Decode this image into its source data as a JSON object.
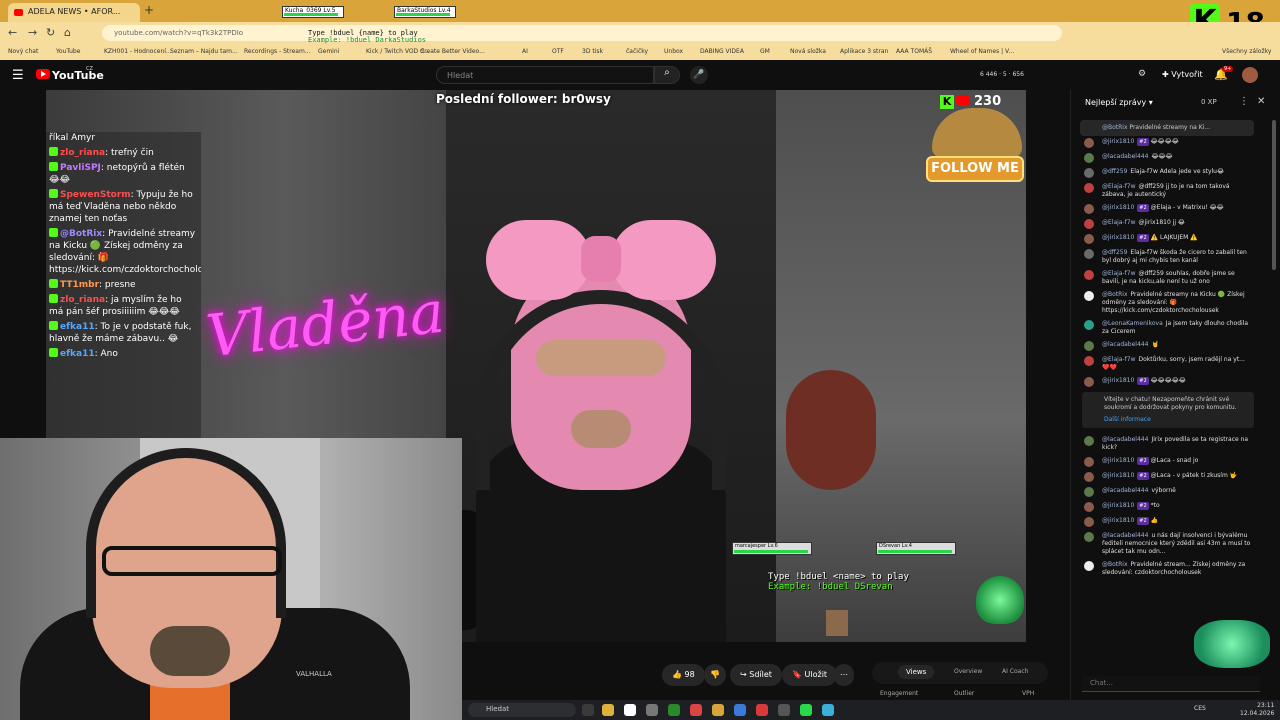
{
  "browser": {
    "tab_title": "ADELA NEWS • AFOR...",
    "url": "youtube.com/watch?v=qTk3k2TPDIo",
    "bookmarks": [
      "Nový chat",
      "YouTube",
      "KZH001 - Hodnocení...",
      "Seznam – Najdu tam...",
      "Recordings - Stream...",
      "Gemini",
      "Kick / Twitch VOD d...",
      "Create Better Video...",
      "AI",
      "OTF",
      "3D tisk",
      "čačičky",
      "Unbox",
      "DABING VIDEA",
      "GM",
      "Nová složka",
      "Aplikace 3 stran",
      "AAA TOMÁŠ",
      "Wheel of Names | V...",
      "Všechny záložky"
    ],
    "hp_bars": [
      "Kucha_0369  Lv.5",
      "BarkaStudios  Lv.4"
    ],
    "kick_badge": {
      "letter": "K",
      "number": "18"
    }
  },
  "cheer_text": {
    "line1": "Type !bduel {name} to play",
    "line2": "Example: !bduel DarkaStudios"
  },
  "youtube": {
    "brand": "YouTube",
    "brand_suffix": "CZ",
    "search_placeholder": "Hledat",
    "stats": "6 446  ·  5  ·  656",
    "create_label": "Vytvořit",
    "notif_count": "9+"
  },
  "stream": {
    "last_follower": "Poslední follower: br0wsy",
    "viewers": "230",
    "follow_me": "FOLLOW ME",
    "neon_sign": "Vladěna",
    "duel_line1": "Type !bduel <name> to play",
    "duel_line2": "Example: !bduel DSrevan",
    "minibars": [
      "marcajesper Lv.6",
      "DSrevan Lv.4"
    ],
    "webcam_brand": "VALHALLA"
  },
  "overlay_chat": [
    {
      "user": "",
      "text": "říkal Amyr",
      "color": "#ffffff"
    },
    {
      "user": "zlo_riana",
      "text": ": trefný čin",
      "color": "#ff4d4d"
    },
    {
      "user": "PavliSPJ",
      "text": ": netopýrů a flétén 😂😂",
      "color": "#c27bff"
    },
    {
      "user": "SpewenStorm",
      "text": ": Typuju že ho má teď Vladěna nebo někdo znamej ten noťas",
      "color": "#ff4d4d"
    },
    {
      "user": "@BotRix",
      "text": ": Pravidelné streamy na Kicku 🟢 Získej odměny za sledování: 🎁 https://kick.com/czdoktorchocholousek",
      "color": "#9b8cff"
    },
    {
      "user": "TT1mbr",
      "text": ": presne",
      "color": "#ff9b4d"
    },
    {
      "user": "zlo_riana",
      "text": ": ja myslím že ho má pán šéf prosiiiiiim 😂😂😂",
      "color": "#ff4d4d"
    },
    {
      "user": "efka11",
      "text": ": To je v podstatě fuk, hlavně že máme zábavu.. 😂",
      "color": "#53a8ff"
    },
    {
      "user": "efka11",
      "text": ": Ano",
      "color": "#53a8ff"
    }
  ],
  "below_video": {
    "likes": "98",
    "share_label": "Sdílet",
    "save_label": "Uložit",
    "tabs": [
      "Views",
      "Overview",
      "AI Coach"
    ],
    "sub_labels": [
      "Engagement",
      "Outlier",
      "VPH"
    ]
  },
  "live_chat": {
    "header": "Nejlepší zprávy",
    "xp": "0 XP",
    "pinned_user": "@BotRix",
    "pinned_text": "Pravidelné streamy na Ki...",
    "input_placeholder": "Chat...",
    "notice": {
      "text": "Vítejte v chatu! Nezapomeňte chránit své soukromí a dodržovat pokyny pro komunitu.",
      "link": "Další informace"
    },
    "messages": [
      {
        "user": "@jirix1810",
        "member": "#2",
        "text": "😂😂😂😂",
        "avatar": "#8a5a4a"
      },
      {
        "user": "@lacadabel444",
        "member": "",
        "text": "😂😂😂",
        "avatar": "#5a7a4a"
      },
      {
        "user": "@dff259",
        "member": "",
        "text": "Elaja-f7w Adela jede ve stylu😂",
        "avatar": "#6a6a6a"
      },
      {
        "user": "@Elaja-f7w",
        "member": "",
        "text": "@dff259 jj to je na tom taková zábava, je autentický",
        "avatar": "#c04040"
      },
      {
        "user": "@jirix1810",
        "member": "#2",
        "text": "@Elaja - v Matrixu! 😂😂",
        "avatar": "#8a5a4a"
      },
      {
        "user": "@Elaja-f7w",
        "member": "",
        "text": "@jirix1810 jj 😂",
        "avatar": "#c04040"
      },
      {
        "user": "@jirix1810",
        "member": "#2",
        "text": "⚠️ LAJKUJEM ⚠️",
        "avatar": "#8a5a4a"
      },
      {
        "user": "@dff259",
        "member": "",
        "text": "Elaja-f7w škoda že cicero to zabalil ten byl dobrý aj mi chybis ten kanál",
        "avatar": "#6a6a6a"
      },
      {
        "user": "@Elaja-f7w",
        "member": "",
        "text": "@dff259 souhlas, dobře jsme se bavili, je na kicku,ale není tu už ono",
        "avatar": "#c04040"
      },
      {
        "user": "@BotRix",
        "member": "",
        "text": "Pravidelné streamy na Kicku 🟢 Získej odměny za sledování: 🎁 https://kick.com/czdoktorchocholousek",
        "avatar": "#eeeeee"
      },
      {
        "user": "@LeonaKamenikova",
        "member": "",
        "text": "Ja jsem taky dlouho chodila za Cicerem",
        "avatar": "#2aa08a"
      },
      {
        "user": "@lacadabel444",
        "member": "",
        "text": "🤘",
        "avatar": "#5a7a4a"
      },
      {
        "user": "@Elaja-f7w",
        "member": "",
        "text": "Doktůrku, sorry, jsem radějí na yt... ❤️❤️",
        "avatar": "#c04040"
      },
      {
        "user": "@jirix1810",
        "member": "#2",
        "text": "😂😂😂😂😂",
        "avatar": "#8a5a4a"
      },
      {
        "user": "@lacadabel444",
        "member": "",
        "text": "Jirix povedila se ta registrace na kick?",
        "avatar": "#5a7a4a"
      },
      {
        "user": "@jirix1810",
        "member": "#2",
        "text": "@Laca - snad jo",
        "avatar": "#8a5a4a"
      },
      {
        "user": "@jirix1810",
        "member": "#2",
        "text": "@Laca - v pátek ti zkusím 🤟",
        "avatar": "#8a5a4a"
      },
      {
        "user": "@lacadabel444",
        "member": "",
        "text": "výborně",
        "avatar": "#5a7a4a"
      },
      {
        "user": "@jirix1810",
        "member": "#2",
        "text": "*to",
        "avatar": "#8a5a4a"
      },
      {
        "user": "@jirix1810",
        "member": "#2",
        "text": "👍",
        "avatar": "#8a5a4a"
      },
      {
        "user": "@lacadabel444",
        "member": "",
        "text": "u nás dají insolvenci i bývalému řediteli nemocnice který zdědil asi 43m a musí to splácet tak mu odn...",
        "avatar": "#5a7a4a"
      },
      {
        "user": "@BotRix",
        "member": "",
        "text": "Pravidelné stream... Získej odměny za sledování: czdoktorchocholousek",
        "avatar": "#eeeeee"
      }
    ]
  },
  "taskbar": {
    "search_label": "Hledat",
    "time": "23:11",
    "date": "12.04.2026",
    "lang": "CES"
  },
  "colors": {
    "kick_green": "#53fc18",
    "youtube_red": "#ff0000",
    "member_purple": "#5b2d9e"
  }
}
